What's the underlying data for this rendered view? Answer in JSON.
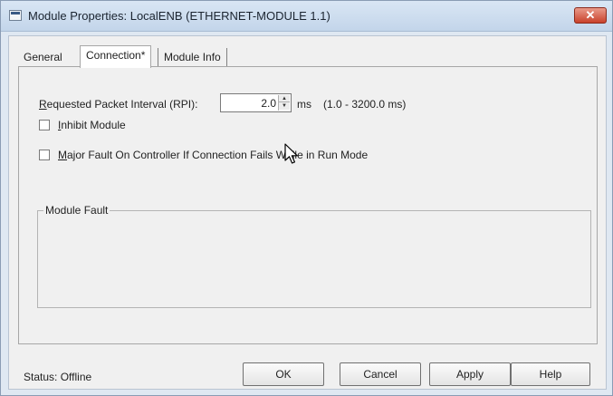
{
  "window": {
    "title": "Module Properties: LocalENB (ETHERNET-MODULE 1.1)",
    "close_label": "✕"
  },
  "tabs": [
    {
      "label": "General",
      "active": false
    },
    {
      "label": "Connection*",
      "active": true
    },
    {
      "label": "Module Info",
      "active": false
    }
  ],
  "connection": {
    "rpi_label_accel": "R",
    "rpi_label_rest": "equested Packet Interval (RPI):",
    "rpi_value": "2.0",
    "rpi_unit": "ms",
    "rpi_range": "(1.0 - 3200.0 ms)",
    "inhibit_accel": "I",
    "inhibit_rest": "nhibit Module",
    "inhibit_checked": false,
    "major_fault_accel": "M",
    "major_fault_rest": "ajor Fault On Controller If Connection Fails While in Run Mode",
    "major_fault_checked": false,
    "module_fault_title": "Module Fault"
  },
  "footer": {
    "status_label": "Status:",
    "status_value": "Offline",
    "ok_label": "OK",
    "cancel_label": "Cancel",
    "apply_label": "Apply",
    "help_label": "Help"
  },
  "icons": {
    "spin_up": "▲",
    "spin_down": "▼",
    "cursor": "arrow-pointer"
  }
}
